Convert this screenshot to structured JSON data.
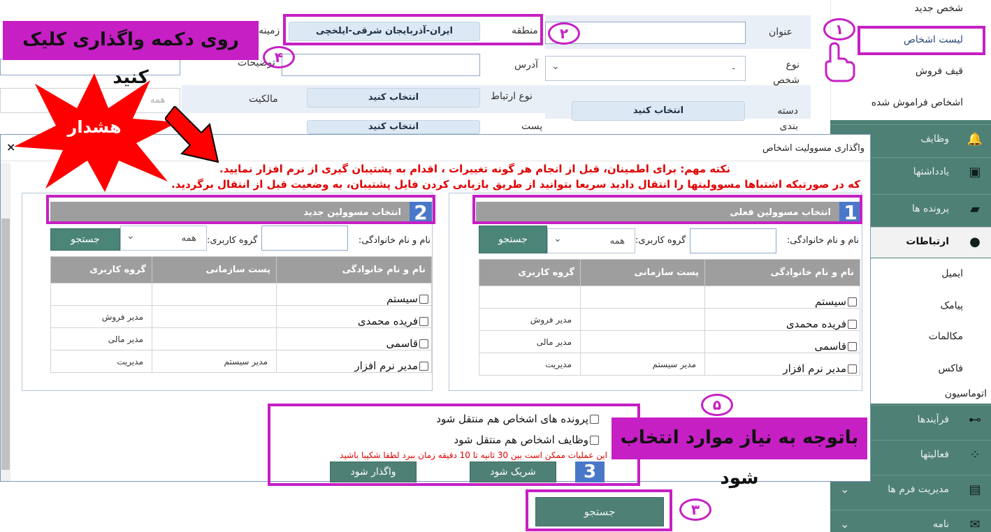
{
  "sidebar": {
    "top_links": [
      "شخص جدید",
      "لیست اشخاص",
      "قیف فروش",
      "اشخاص فراموش شده"
    ],
    "sections": [
      {
        "label": "وظایف",
        "icon": "bell-icon"
      },
      {
        "label": "یادداشتها",
        "icon": "note-icon"
      },
      {
        "label": "پرونده ها",
        "icon": "folder-icon"
      },
      {
        "label": "ارتباطات",
        "icon": "person-icon"
      }
    ],
    "comm_items": [
      "ایمیل",
      "پیامک",
      "مکالمات",
      "فاکس"
    ],
    "automation": "اتوماسیون",
    "lower_sections": [
      {
        "label": "فرآیندها",
        "icon": "flow-icon"
      },
      {
        "label": "فعالیتها",
        "icon": "dots-icon"
      },
      {
        "label": "مدیریت فرم ها",
        "icon": "form-icon"
      },
      {
        "label": "نامه",
        "icon": "mail-icon"
      }
    ]
  },
  "bg_form": {
    "title_label": "عنوان",
    "region_label": "منطقه",
    "region_value": "ایران-آذربایجان شرقی-ایلخچی",
    "field_label": "زمینه",
    "person_type_label": "نوع شخص",
    "person_type_value": "-",
    "address_label": "آدرس",
    "desc_label": "توضیحات",
    "relation_label": "نوع ارتباط",
    "ownership_label": "مالکیت",
    "ownership_placeholder": "همه",
    "category_label": "دسته بندی",
    "post_label": "پست",
    "select_label": "انتخاب کنید"
  },
  "modal": {
    "title": "واگذاری مسوولیت اشخاص",
    "close": "×",
    "warning_1": "نکته مهم: برای اطمینان، قبل از انجام هر گونه تغییرات ، اقدام به پشتیبان گیری از نرم افزار نمایید.",
    "warning_2": "که در صورتیکه اشتباها مسوولیتها را انتقال دادید سریعا بتوانید از طریق بازیابی کردن فایل پشتیبان، به وضعیت قبل از انتقال برگردید.",
    "current": {
      "header": "انتخاب مسوولین فعلی",
      "badge": "1",
      "name_label": "نام و نام خانوادگی:",
      "group_label": "گروه کاربری:",
      "group_value": "همه",
      "search": "جستجو"
    },
    "new": {
      "header": "انتخاب مسوولین جدید",
      "badge": "2",
      "name_label": "نام و نام خانوادگی:",
      "group_label": "گروه کاربری:",
      "group_value": "همه",
      "search": "جستجو"
    },
    "columns": [
      "نام و نام خانوادگی",
      "پست سازمانی",
      "گروه کاربری"
    ],
    "rows": [
      {
        "name": "سیستم",
        "post": "",
        "group": ""
      },
      {
        "name": "فریده محمدی",
        "post": "",
        "group": "مدیر فروش"
      },
      {
        "name": "قاسمی",
        "post": "",
        "group": "مدیر مالی"
      },
      {
        "name": "مدیر نرم افزار",
        "post": "مدیر سیستم",
        "group": "مدیریت"
      }
    ],
    "options": {
      "files": "پرونده های اشخاص هم منتقل شود",
      "tasks": "وظایف اشخاص هم منتقل شود",
      "note": "این عملیات ممکن است بین 30 ثانیه تا 10 دقیقه زمان ببرد لطفا شکیبا باشید",
      "badge": "3",
      "share": "شریک شود",
      "assign": "واگذار شود"
    }
  },
  "bottom_search": "جستجو",
  "annotations": {
    "click_assign": "روی دکمه واگذاری کلیک کنید",
    "warning": "هشدار",
    "select_needed": "باتوجه به نیاز موارد انتخاب شود",
    "n1": "۱",
    "n2": "۲",
    "n3": "۳",
    "n4": "۴",
    "n5": "۵"
  },
  "colors": {
    "sidebar": "#4f8075",
    "annotation": "#c61fc4",
    "warning_text": "#e00000",
    "badge": "#4a78c9"
  }
}
